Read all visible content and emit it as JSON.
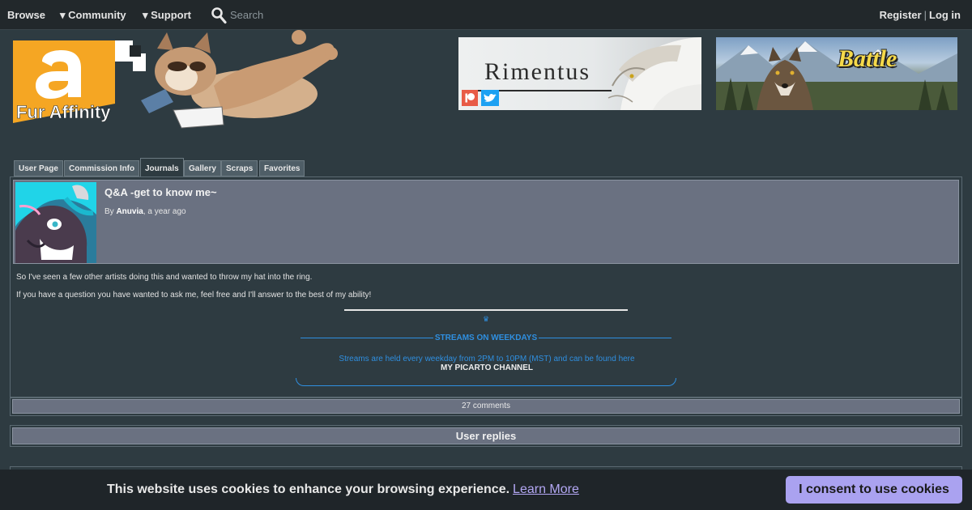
{
  "nav": {
    "browse": "Browse",
    "community": "▾ Community",
    "support": "▾ Support",
    "search_placeholder": "Search",
    "register": "Register",
    "separator": "|",
    "login": "Log in"
  },
  "logo": {
    "text": "Fur Affinity"
  },
  "banners": {
    "rimentus": "Rimentus",
    "battle": "Battle"
  },
  "tabs": [
    "User Page",
    "Commission Info",
    "Journals",
    "Gallery",
    "Scraps",
    "Favorites"
  ],
  "active_tab": "Journals",
  "journal": {
    "title": "Q&A -get to know me~",
    "by_prefix": "By ",
    "author": "Anuvia",
    "time": ", a year ago",
    "para1": "So I've seen a few other artists doing this and wanted to throw my hat into the ring.",
    "para2": "If you have a question you have wanted to ask me, feel free and I'll answer to the best of my ability!",
    "crown": "♛",
    "streams_title": "STREAMS ON WEEKDAYS",
    "streams_desc": "Streams are held every weekday from 2PM to 10PM (MST) and can be found here",
    "picarto": "MY PICARTO CHANNEL"
  },
  "comments": {
    "label": "27 comments"
  },
  "replies": {
    "label": "User replies"
  },
  "cookie": {
    "message": "This website uses cookies to enhance your browsing experience.",
    "learn_more": "Learn More",
    "button": "I consent to use cookies"
  },
  "colors": {
    "accent": "#2f8fe0",
    "panel": "#6a7181",
    "background": "#2e3b41",
    "cookie_button": "#aaa2f0"
  }
}
